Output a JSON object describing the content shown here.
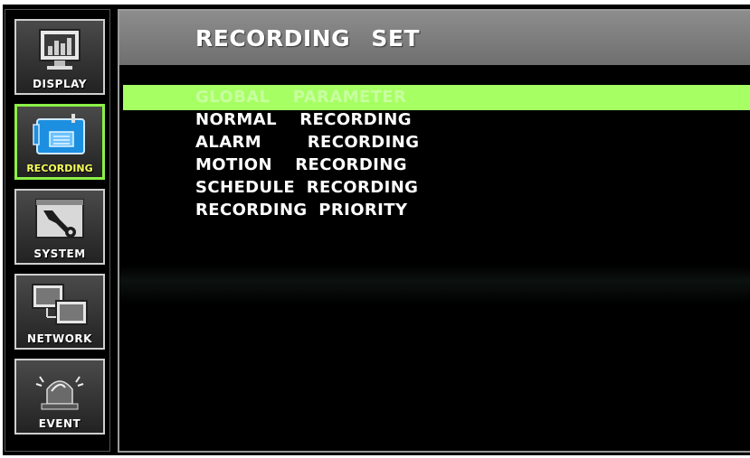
{
  "sidebar": {
    "items": [
      {
        "label": "DISPLAY",
        "icon": "monitor-icon",
        "active": false
      },
      {
        "label": "RECORDING",
        "icon": "camera-icon",
        "active": true
      },
      {
        "label": "SYSTEM",
        "icon": "wrench-icon",
        "active": false
      },
      {
        "label": "NETWORK",
        "icon": "network-icon",
        "active": false
      },
      {
        "label": "EVENT",
        "icon": "alarm-light-icon",
        "active": false
      }
    ]
  },
  "main": {
    "title": "RECORDING   SET",
    "menu": [
      {
        "label": "GLOBAL  PARAMETER",
        "selected": true
      },
      {
        "label": "NORMAL  RECORDING",
        "selected": false
      },
      {
        "label": "ALARM    RECORDING",
        "selected": false
      },
      {
        "label": "MOTION  RECORDING",
        "selected": false
      },
      {
        "label": "SCHEDULE RECORDING",
        "selected": false
      },
      {
        "label": "RECORDING PRIORITY",
        "selected": false
      }
    ]
  },
  "colors": {
    "accent_green": "#a6ff63",
    "active_border": "#8cf046",
    "active_label": "#f6ff5a",
    "header_gray": "#7d7d7d"
  }
}
